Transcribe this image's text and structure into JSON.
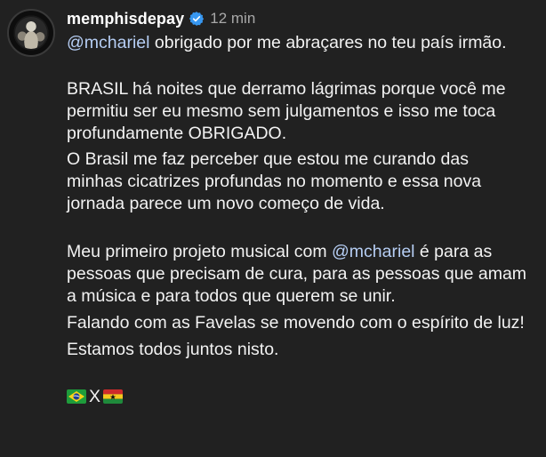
{
  "post": {
    "username": "memphisdepay",
    "time_ago": "12 min",
    "paragraph1": {
      "mention": "@mchariel",
      "text": " obrigado por me abraçares no teu país irmão."
    },
    "paragraph2": "BRASIL há noites que derramo lágrimas porque você me permitiu ser eu mesmo sem julgamentos e isso me toca profundamente OBRIGADO.",
    "paragraph3": "O Brasil me faz perceber que estou me curando das minhas cicatrizes profundas no momento e essa nova jornada parece um novo começo de vida.",
    "paragraph4": {
      "before": "Meu primeiro projeto musical com ",
      "mention": "@mchariel",
      "after": " é para as pessoas que precisam de cura, para as pessoas que amam a música e para todos que querem se unir."
    },
    "paragraph5": "Falando com as Favelas se movendo com o espírito de luz!",
    "paragraph6": "Estamos todos juntos nisto.",
    "emoji_line": {
      "flag1": "brazil-flag",
      "separator": "X",
      "flag2": "ghana-flag"
    }
  },
  "colors": {
    "background": "#212121",
    "mention": "#b5cdf3",
    "verified_badge": "#3797f0",
    "timestamp": "#a8a8a8"
  }
}
